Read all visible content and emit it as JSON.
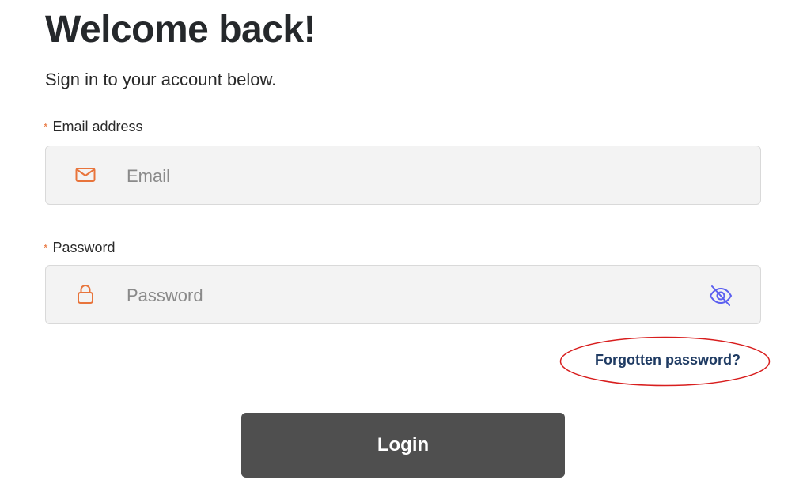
{
  "header": {
    "title": "Welcome back!",
    "subtitle": "Sign in to your account below."
  },
  "form": {
    "email": {
      "required_mark": "*",
      "label": "Email address",
      "placeholder": "Email",
      "value": "",
      "icon": "mail-icon"
    },
    "password": {
      "required_mark": "*",
      "label": "Password",
      "placeholder": "Password",
      "value": "",
      "icon": "lock-icon",
      "toggle_icon": "eye-off-icon"
    },
    "forgot_link": "Forgotten password?",
    "login_label": "Login"
  },
  "colors": {
    "accent_icon": "#e8743b",
    "toggle_icon": "#5b5ff0",
    "link": "#1f3b63",
    "button_bg": "#4f4f4f",
    "annotation": "#d81e1e"
  }
}
